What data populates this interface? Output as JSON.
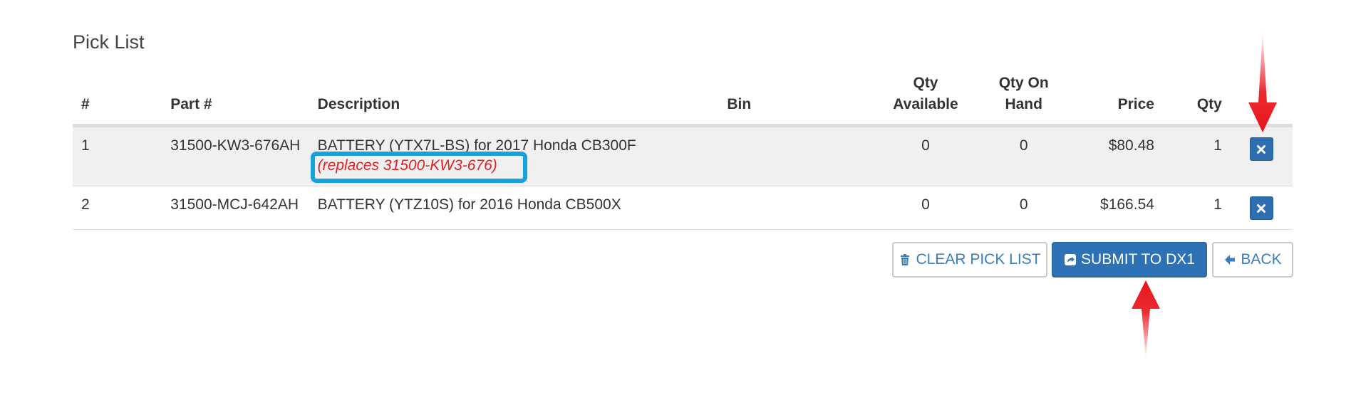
{
  "page": {
    "title": "Pick List"
  },
  "table": {
    "headers": {
      "num": "#",
      "part": "Part #",
      "description": "Description",
      "bin": "Bin",
      "qty_available_1": "Qty",
      "qty_available_2": "Available",
      "qty_on_hand_1": "Qty On",
      "qty_on_hand_2": "Hand",
      "price": "Price",
      "qty": "Qty"
    },
    "rows": [
      {
        "num": "1",
        "part": "31500-KW3-676AH",
        "description": "BATTERY (YTX7L-BS) for 2017 Honda CB300F",
        "replaces": "(replaces 31500-KW3-676)",
        "bin": "",
        "qty_available": "0",
        "qty_on_hand": "0",
        "price": "$80.48",
        "qty": "1"
      },
      {
        "num": "2",
        "part": "31500-MCJ-642AH",
        "description": "BATTERY (YTZ10S) for 2016 Honda CB500X",
        "bin": "",
        "qty_available": "0",
        "qty_on_hand": "0",
        "price": "$166.54",
        "qty": "1"
      }
    ]
  },
  "actions": {
    "clear_label": "CLEAR PICK LIST",
    "submit_label": "SUBMIT TO DX1",
    "back_label": "BACK"
  },
  "icons": {
    "delete": "times-icon",
    "clear": "trash-icon",
    "submit": "share-square-icon",
    "back": "arrow-left-icon"
  },
  "colors": {
    "primary": "#2e72b5",
    "highlight_box": "#16a2dd",
    "replaces_text": "#e02020",
    "annotation_arrow": "#e8141b"
  }
}
